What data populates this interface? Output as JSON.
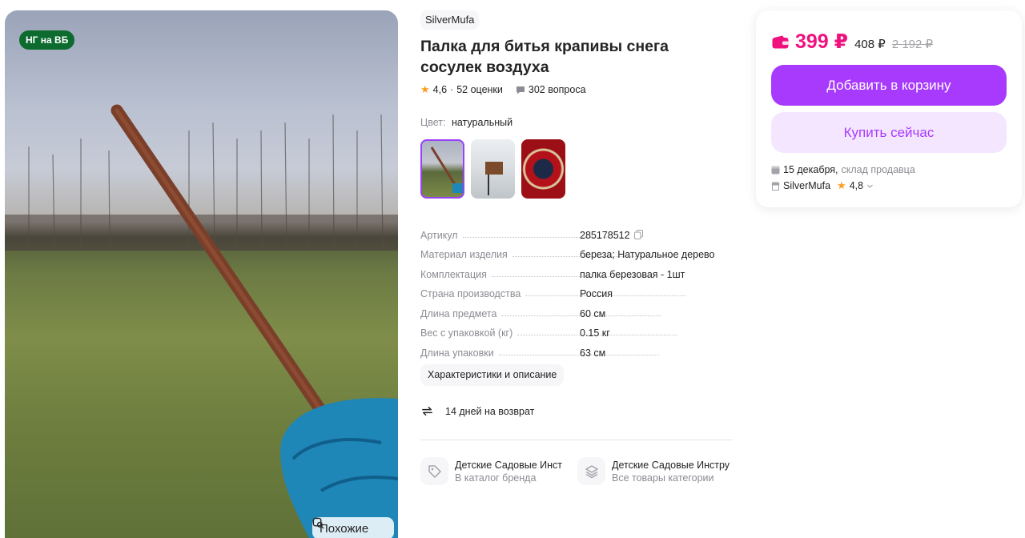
{
  "photo": {
    "badge": "НГ на ВБ",
    "similar_label": "Похожие"
  },
  "product": {
    "brand": "SilverMufa",
    "title": "Палка для битья крапивы снега сосулек воздуха",
    "rating": "4,6",
    "reviews": "52 оценки",
    "questions": "302 вопроса",
    "color_label": "Цвет:",
    "color_value": "натуральный"
  },
  "specs": [
    {
      "key": "Артикул",
      "value": "285178512"
    },
    {
      "key": "Материал изделия",
      "value": "береза; Натуральное дерево"
    },
    {
      "key": "Комплектация",
      "value": "палка березовая - 1шт"
    },
    {
      "key": "Страна производства",
      "value": "Россия"
    },
    {
      "key": "Длина предмета",
      "value": "60 см"
    },
    {
      "key": "Вес с упаковкой (кг)",
      "value": "0.15 кг"
    },
    {
      "key": "Длина упаковки",
      "value": "63 см"
    }
  ],
  "chars_button": "Характеристики и описание",
  "return_text": "14 дней на возврат",
  "links": [
    {
      "title": "Детские Садовые Инст",
      "subtitle": "В каталог бренда"
    },
    {
      "title": "Детские Садовые Инстру",
      "subtitle": "Все товары категории"
    }
  ],
  "buy": {
    "price": "399 ₽",
    "price_without_wallet": "408 ₽",
    "price_old": "2 192 ₽",
    "add_to_cart": "Добавить в корзину",
    "buy_now": "Купить сейчас",
    "delivery_date": "15 декабря,",
    "delivery_source": "склад продавца",
    "seller": "SilverMufa",
    "seller_rating": "4,8"
  },
  "colors": {
    "accent": "#a73afd",
    "price": "#f1117e",
    "badge": "#0d6b2f",
    "star": "#ff9a1f"
  },
  "icons": [
    "search-similar-icon",
    "star-icon",
    "question-icon",
    "copy-icon",
    "return-icon",
    "tag-icon",
    "layers-icon",
    "wallet-icon",
    "box-icon",
    "store-icon",
    "chevron-down-icon"
  ]
}
